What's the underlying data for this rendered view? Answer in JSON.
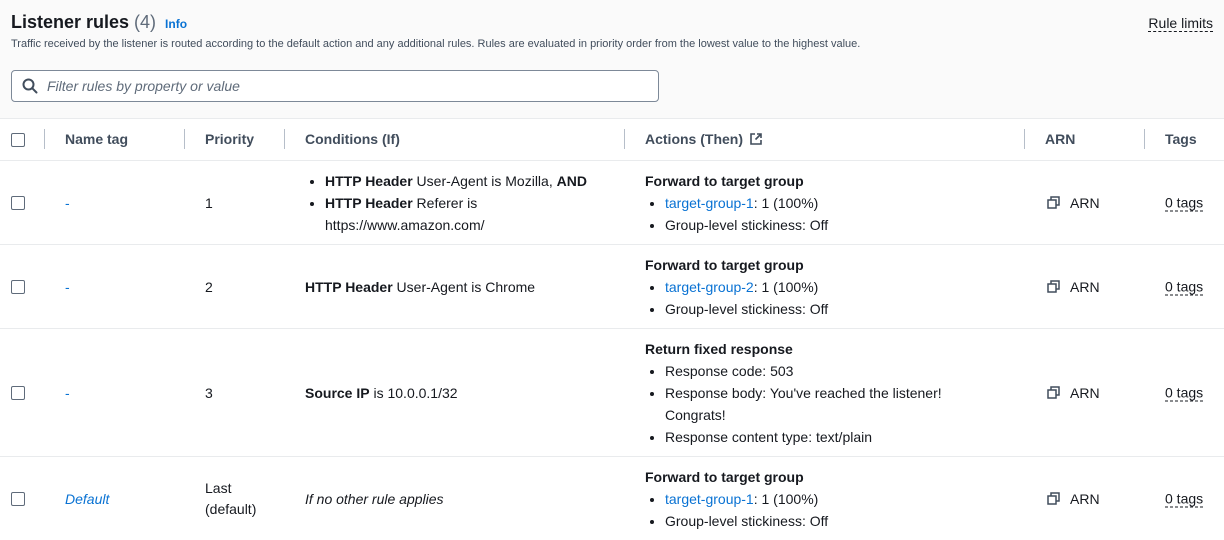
{
  "header": {
    "title": "Listener rules",
    "count": "(4)",
    "info": "Info",
    "description": "Traffic received by the listener is routed according to the default action and any additional rules. Rules are evaluated in priority order from the lowest value to the highest value.",
    "rule_limits": "Rule limits",
    "filter_placeholder": "Filter rules by property or value",
    "filter_value": ""
  },
  "columns": {
    "name_tag": "Name tag",
    "priority": "Priority",
    "conditions": "Conditions (If)",
    "actions": "Actions (Then)",
    "arn": "ARN",
    "tags": "Tags"
  },
  "rows": [
    {
      "name": "-",
      "priority": "1",
      "conditions": [
        {
          "bold": "HTTP Header",
          "text": " User-Agent is Mozilla, ",
          "suffix_bold": "AND"
        },
        {
          "bold": "HTTP Header",
          "text": " Referer is",
          "line2": "https://www.amazon.com/"
        }
      ],
      "action_title": "Forward to target group",
      "target_group": "target-group-1",
      "target_weight": ": 1 (100%)",
      "stickiness": "Group-level stickiness: Off",
      "arn": "ARN",
      "tags": "0 tags"
    },
    {
      "name": "-",
      "priority": "2",
      "condition_bold": "HTTP Header",
      "condition_text": " User-Agent is Chrome",
      "action_title": "Forward to target group",
      "target_group": "target-group-2",
      "target_weight": ": 1 (100%)",
      "stickiness": "Group-level stickiness: Off",
      "arn": "ARN",
      "tags": "0 tags"
    },
    {
      "name": "-",
      "priority": "3",
      "condition_bold": "Source IP",
      "condition_text": " is 10.0.0.1/32",
      "action_title": "Return fixed response",
      "response_code": "Response code: 503",
      "response_body_1": "Response body: You've reached the listener!",
      "response_body_2": "Congrats!",
      "content_type": "Response content type: text/plain",
      "arn": "ARN",
      "tags": "0 tags"
    },
    {
      "name": "Default",
      "priority_1": "Last",
      "priority_2": "(default)",
      "condition": "If no other rule applies",
      "action_title": "Forward to target group",
      "target_group": "target-group-1",
      "target_weight": ": 1 (100%)",
      "stickiness": "Group-level stickiness: Off",
      "arn": "ARN",
      "tags": "0 tags"
    }
  ],
  "icons": {
    "search": "search-icon",
    "external": "external-link-icon",
    "copy": "copy-icon"
  },
  "colors": {
    "link": "#0972d3",
    "text": "#16191f",
    "header_bg": "#fafafa"
  }
}
